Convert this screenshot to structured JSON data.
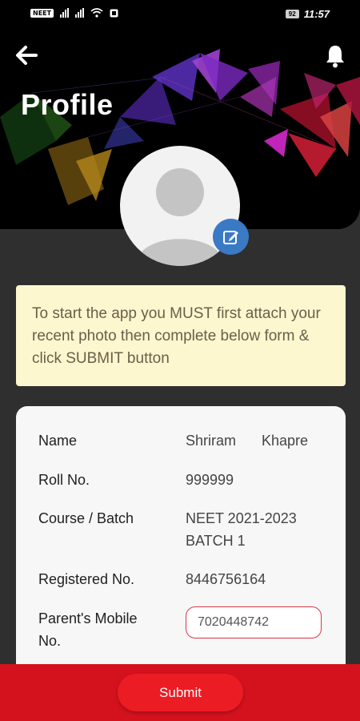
{
  "status_bar": {
    "carrier_chip": "NEET",
    "battery": "92",
    "time": "11:57"
  },
  "header": {
    "title": "Profile",
    "back_icon": "arrow-left-icon",
    "bell_icon": "bell-icon"
  },
  "avatar": {
    "icon": "person-placeholder-icon",
    "edit_icon": "edit-icon"
  },
  "notice": {
    "text": "To start the app you MUST first attach your recent photo then complete below form & click SUBMIT button"
  },
  "profile": {
    "name_label": "Name",
    "first_name": "Shriram",
    "last_name": "Khapre",
    "roll_label": "Roll No.",
    "roll_value": "999999",
    "course_label": "Course / Batch",
    "course_line1": "NEET 2021-2023",
    "course_line2": "BATCH 1",
    "registered_label": "Registered No.",
    "registered_value": "8446756164",
    "parent_label_line1": "Parent's Mobile",
    "parent_label_line2": "No.",
    "parent_value": "7020448742"
  },
  "footer": {
    "submit_label": "Submit"
  },
  "colors": {
    "accent_red": "#ec1c24",
    "footer_red": "#d4121e",
    "edit_blue": "#3a7ac5",
    "notice_bg": "#fdf7cf",
    "field_border": "#d9374a"
  }
}
